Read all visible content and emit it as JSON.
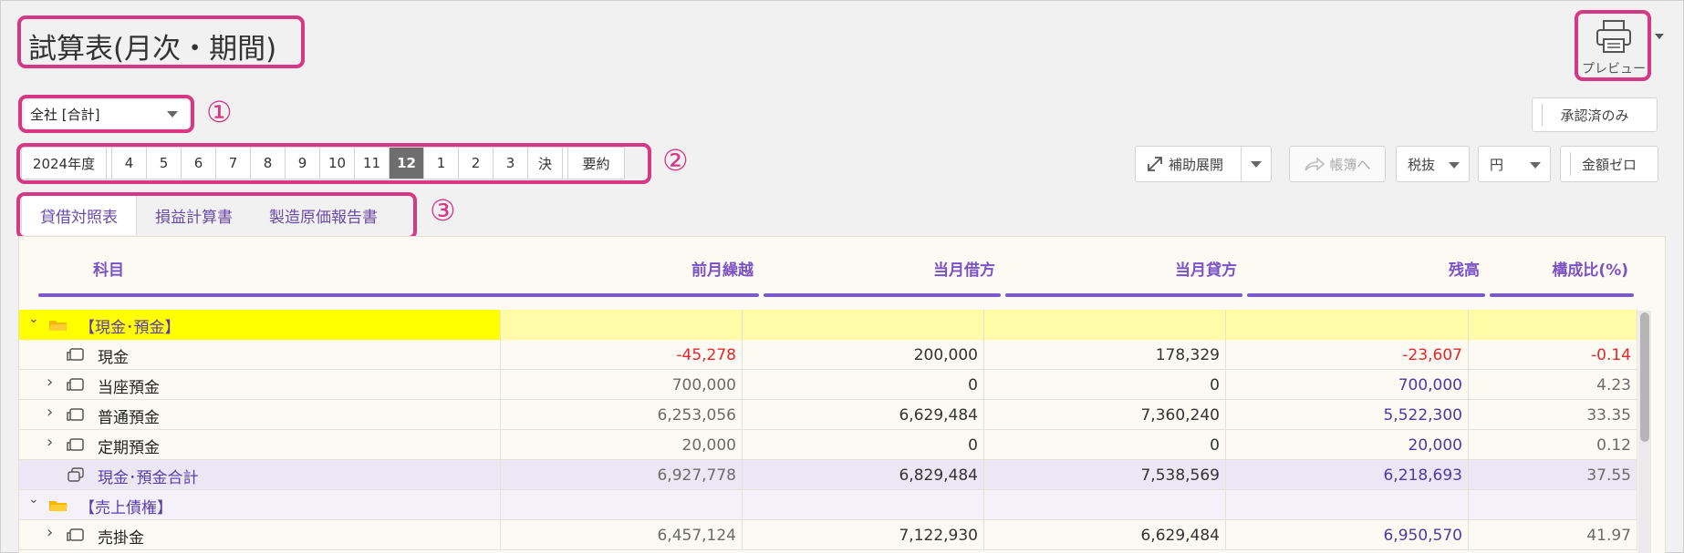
{
  "title": "試算表(月次・期間)",
  "print": {
    "label": "プレビュー"
  },
  "company_select": {
    "value": "全社 [合計]"
  },
  "approved_button": "承認済のみ",
  "callouts": [
    "①",
    "②",
    "③"
  ],
  "period_bar": {
    "year": "2024年度",
    "months": [
      "4",
      "5",
      "6",
      "7",
      "8",
      "9",
      "10",
      "11",
      "12",
      "1",
      "2",
      "3",
      "決"
    ],
    "selected": "12",
    "summary": "要約"
  },
  "toolbar": {
    "expand": "補助展開",
    "ledger": "帳簿へ",
    "tax": "税抜",
    "currency": "円",
    "zero": "金額ゼロ"
  },
  "tabs": [
    "貸借対照表",
    "損益計算書",
    "製造原価報告書"
  ],
  "table": {
    "headers": [
      "科目",
      "前月繰越",
      "当月借方",
      "当月貸方",
      "残高",
      "構成比(%)"
    ],
    "rows": [
      {
        "type": "group",
        "name": "【現金･預金】",
        "values": [
          "",
          "",
          "",
          "",
          ""
        ]
      },
      {
        "type": "item",
        "name": "現金",
        "values": [
          "-45,278",
          "200,000",
          "178,329",
          "-23,607",
          "-0.14"
        ]
      },
      {
        "type": "item",
        "name": "当座預金",
        "values": [
          "700,000",
          "0",
          "0",
          "700,000",
          "4.23"
        ]
      },
      {
        "type": "item",
        "name": "普通預金",
        "values": [
          "6,253,056",
          "6,629,484",
          "7,360,240",
          "5,522,300",
          "33.35"
        ]
      },
      {
        "type": "item",
        "name": "定期預金",
        "values": [
          "20,000",
          "0",
          "0",
          "20,000",
          "0.12"
        ]
      },
      {
        "type": "total",
        "name": "現金･預金合計",
        "values": [
          "6,927,778",
          "6,829,484",
          "7,538,569",
          "6,218,693",
          "37.55"
        ]
      },
      {
        "type": "group",
        "name": "【売上債権】",
        "values": [
          "",
          "",
          "",
          "",
          ""
        ]
      },
      {
        "type": "item",
        "name": "売掛金",
        "values": [
          "6,457,124",
          "7,122,930",
          "6,629,484",
          "6,950,570",
          "41.97"
        ]
      }
    ]
  },
  "colors": {
    "highlight": "#d63884",
    "accent": "#7b5cc6",
    "negative": "#e5262b",
    "balance": "#4e3aa0"
  }
}
